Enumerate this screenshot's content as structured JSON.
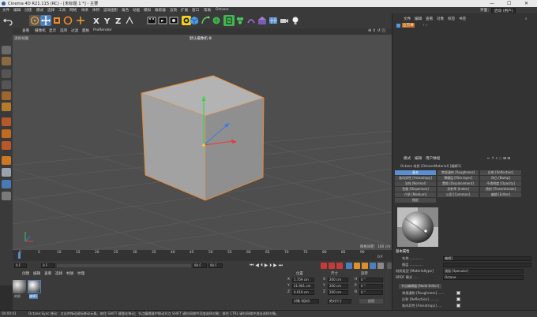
{
  "window": {
    "title": "Cinema 4D R21.115 (RC) - [未标题 1 *] - 主要",
    "controls": [
      "—",
      "☐",
      "✕"
    ]
  },
  "menu": {
    "left": [
      "文件",
      "编辑",
      "创建",
      "模式",
      "选择",
      "工具",
      "网格",
      "样条",
      "体积",
      "运动图形",
      "角色",
      "动画",
      "模拟",
      "跟踪器",
      "渲染",
      "扩展",
      "窗口",
      "帮助",
      "Octane"
    ],
    "right": [
      "界面：",
      "启动 (用户)"
    ]
  },
  "viewport": {
    "menu": [
      "查看",
      "摄像机",
      "显示",
      "选项",
      "过滤",
      "面板",
      "ProRender"
    ],
    "label": "透视视图",
    "camera": "默认摄像机 ⦾",
    "grid_info": "网格间距：100 cm",
    "colors": {
      "bg": "#4e4e4e",
      "cube": "#a7a7a7",
      "edge": "#f08a28"
    }
  },
  "timeline": {
    "ticks": [
      "0",
      "5",
      "10",
      "15",
      "20",
      "25",
      "30",
      "35",
      "40",
      "45",
      "50",
      "55",
      "60",
      "65",
      "70",
      "75",
      "80",
      "85",
      "90"
    ],
    "end_label": "0 F",
    "current_frame": "0 F",
    "min_frame": "0 F",
    "max_frame": "90 F",
    "max_frame2": "90 F"
  },
  "object_manager": {
    "menu": [
      "文件",
      "编辑",
      "查看",
      "对象",
      "标签",
      "书签"
    ],
    "object_name": "立方体"
  },
  "attributes": {
    "menu": [
      "模式",
      "编辑",
      "用户数据"
    ],
    "material_title": "Octane 材质 [OctaneMaterial] [编辑1]",
    "tabs": [
      [
        "基本",
        "常规漫射 [Roughness]",
        "反射 [Reflection]"
      ],
      [
        "各向异性 [Anisotropy]",
        "薄膜层 [Film layer]",
        "凹凸 [Bump]"
      ],
      [
        "法线 [Normal]",
        "置换 [Displacement]",
        "不透明度 [Opacity]"
      ],
      [
        "色散 [Dispersion]",
        "折射率 [Index]",
        "透射 [Transmission]"
      ],
      [
        "介质 [Medium]",
        "公用 [Common]",
        "编辑 [Editor]"
      ]
    ],
    "extra_tab": "指定",
    "section": "基本属性",
    "fields": [
      {
        "label": "名称 .............",
        "value": "编辑1",
        "type": "text"
      },
      {
        "label": "图层 .............",
        "value": "",
        "type": "text"
      },
      {
        "label": "材质类型 [Materialtype]",
        "value": "镜面 [Specular]",
        "type": "select"
      },
      {
        "label": "BRDF 模式 .....",
        "value": "Octane",
        "type": "select"
      }
    ],
    "node_button": "节点编辑器 [Node Editor]",
    "checks": [
      {
        "label": "常规漫射 [Roughness] ......",
        "checked": true
      },
      {
        "label": "反射 [Reflection] .........",
        "checked": true
      },
      {
        "label": "各向异性 [Anisotropy] ....",
        "checked": true
      },
      {
        "label": "薄膜层 [Film layer] .......",
        "checked": true
      }
    ]
  },
  "material_manager": {
    "menu": [
      "创建",
      "编辑",
      "查看",
      "选择",
      "材质",
      "纹理"
    ],
    "materials": [
      "材质",
      "编辑1"
    ]
  },
  "coordinates": {
    "headers": [
      "位置",
      "尺寸",
      "旋转"
    ],
    "rows": [
      {
        "axis": "X",
        "pos": "1.759 cm",
        "axis2": "X",
        "size": "200 cm",
        "rot_axis": "H",
        "rot": "0 °"
      },
      {
        "axis": "Y",
        "pos": "21.901 cm",
        "axis2": "Y",
        "size": "200 cm",
        "rot_axis": "P",
        "rot": "0 °"
      },
      {
        "axis": "Z",
        "pos": "0.019 cm",
        "axis2": "Z",
        "size": "200 cm",
        "rot_axis": "B",
        "rot": "0 °"
      }
    ],
    "mode1": "对象 (相对)",
    "mode2": "绝对尺寸",
    "apply": "应用"
  },
  "status": {
    "time": "00:00:01",
    "text": "Octane:Sync  移动：点击并拖动鼠标移动元素。按住 SHIFT 键量化移动；节点编辑器中移动节点 SHIFT 键在网络中添加选择对象；按住 CTRL 键在网络中减去选择对象。"
  }
}
